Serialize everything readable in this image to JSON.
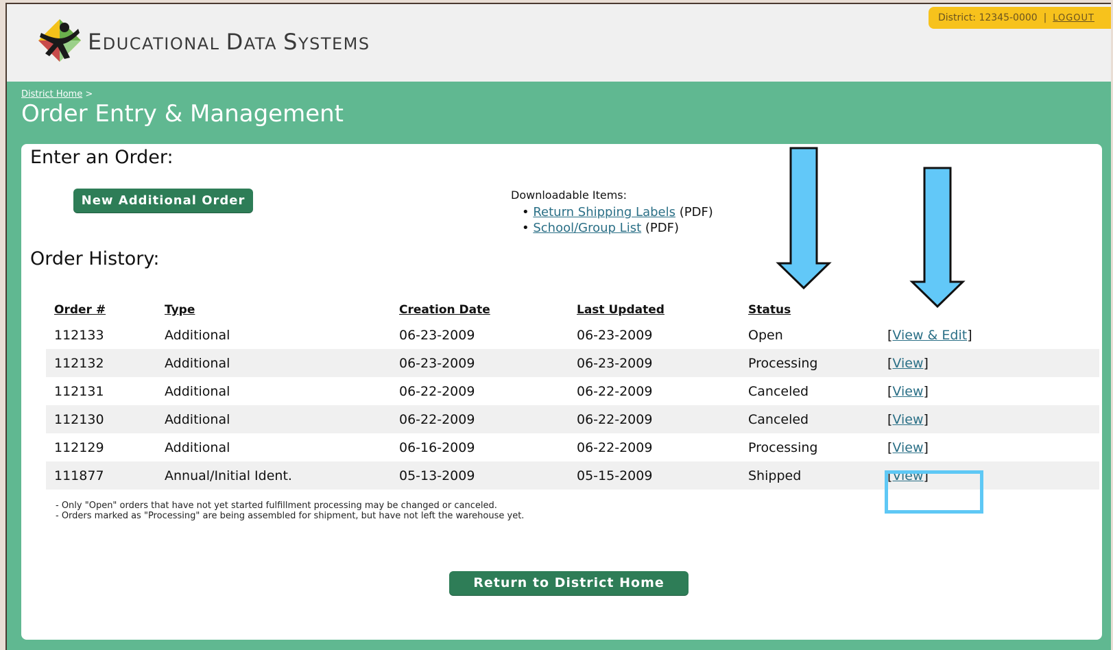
{
  "header": {
    "brand_first": "E",
    "brand_rest_1": "DUCATIONAL ",
    "brand_d": "D",
    "brand_rest_2": "ATA ",
    "brand_s": "S",
    "brand_rest_3": "YSTEMS",
    "district_label": "District: 12345-0000",
    "separator": "|",
    "logout_label": "LOGOUT"
  },
  "breadcrumb": {
    "home_link": "District Home",
    "separator": ">"
  },
  "page_title": "Order Entry & Management",
  "enter_order": {
    "heading": "Enter an Order:",
    "new_order_button": "New Additional Order"
  },
  "downloads": {
    "heading": "Downloadable Items:",
    "items": [
      {
        "link": "Return Shipping Labels",
        "suffix": " (PDF)"
      },
      {
        "link": "School/Group List",
        "suffix": " (PDF)"
      }
    ]
  },
  "order_history": {
    "heading": "Order History:",
    "columns": [
      "Order #",
      "Type",
      "Creation Date",
      "Last Updated",
      "Status"
    ],
    "rows": [
      {
        "order": "112133",
        "type": "Additional",
        "created": "06-23-2009",
        "updated": "06-23-2009",
        "status": "Open",
        "action": "View & Edit"
      },
      {
        "order": "112132",
        "type": "Additional",
        "created": "06-23-2009",
        "updated": "06-23-2009",
        "status": "Processing",
        "action": "View"
      },
      {
        "order": "112131",
        "type": "Additional",
        "created": "06-22-2009",
        "updated": "06-22-2009",
        "status": "Canceled",
        "action": "View"
      },
      {
        "order": "112130",
        "type": "Additional",
        "created": "06-22-2009",
        "updated": "06-22-2009",
        "status": "Canceled",
        "action": "View"
      },
      {
        "order": "112129",
        "type": "Additional",
        "created": "06-16-2009",
        "updated": "06-22-2009",
        "status": "Processing",
        "action": "View"
      },
      {
        "order": "111877",
        "type": "Annual/Initial Ident.",
        "created": "05-13-2009",
        "updated": "05-15-2009",
        "status": "Shipped",
        "action": "View"
      }
    ],
    "notes": [
      "- Only \"Open\" orders that have not yet started fulfillment processing may be changed or canceled.",
      "- Orders marked as \"Processing\" are being assembled for shipment, but have not left the warehouse yet."
    ]
  },
  "return_button": "Return to District Home",
  "colors": {
    "page_green": "#60b891",
    "button_green": "#2e7d57",
    "district_bar": "#f7c21c",
    "annotation_blue": "#5ec8f5",
    "link": "#2a6f86"
  },
  "icons": {
    "logo": "person-star-logo-icon",
    "annotation": "down-arrow-icon"
  }
}
